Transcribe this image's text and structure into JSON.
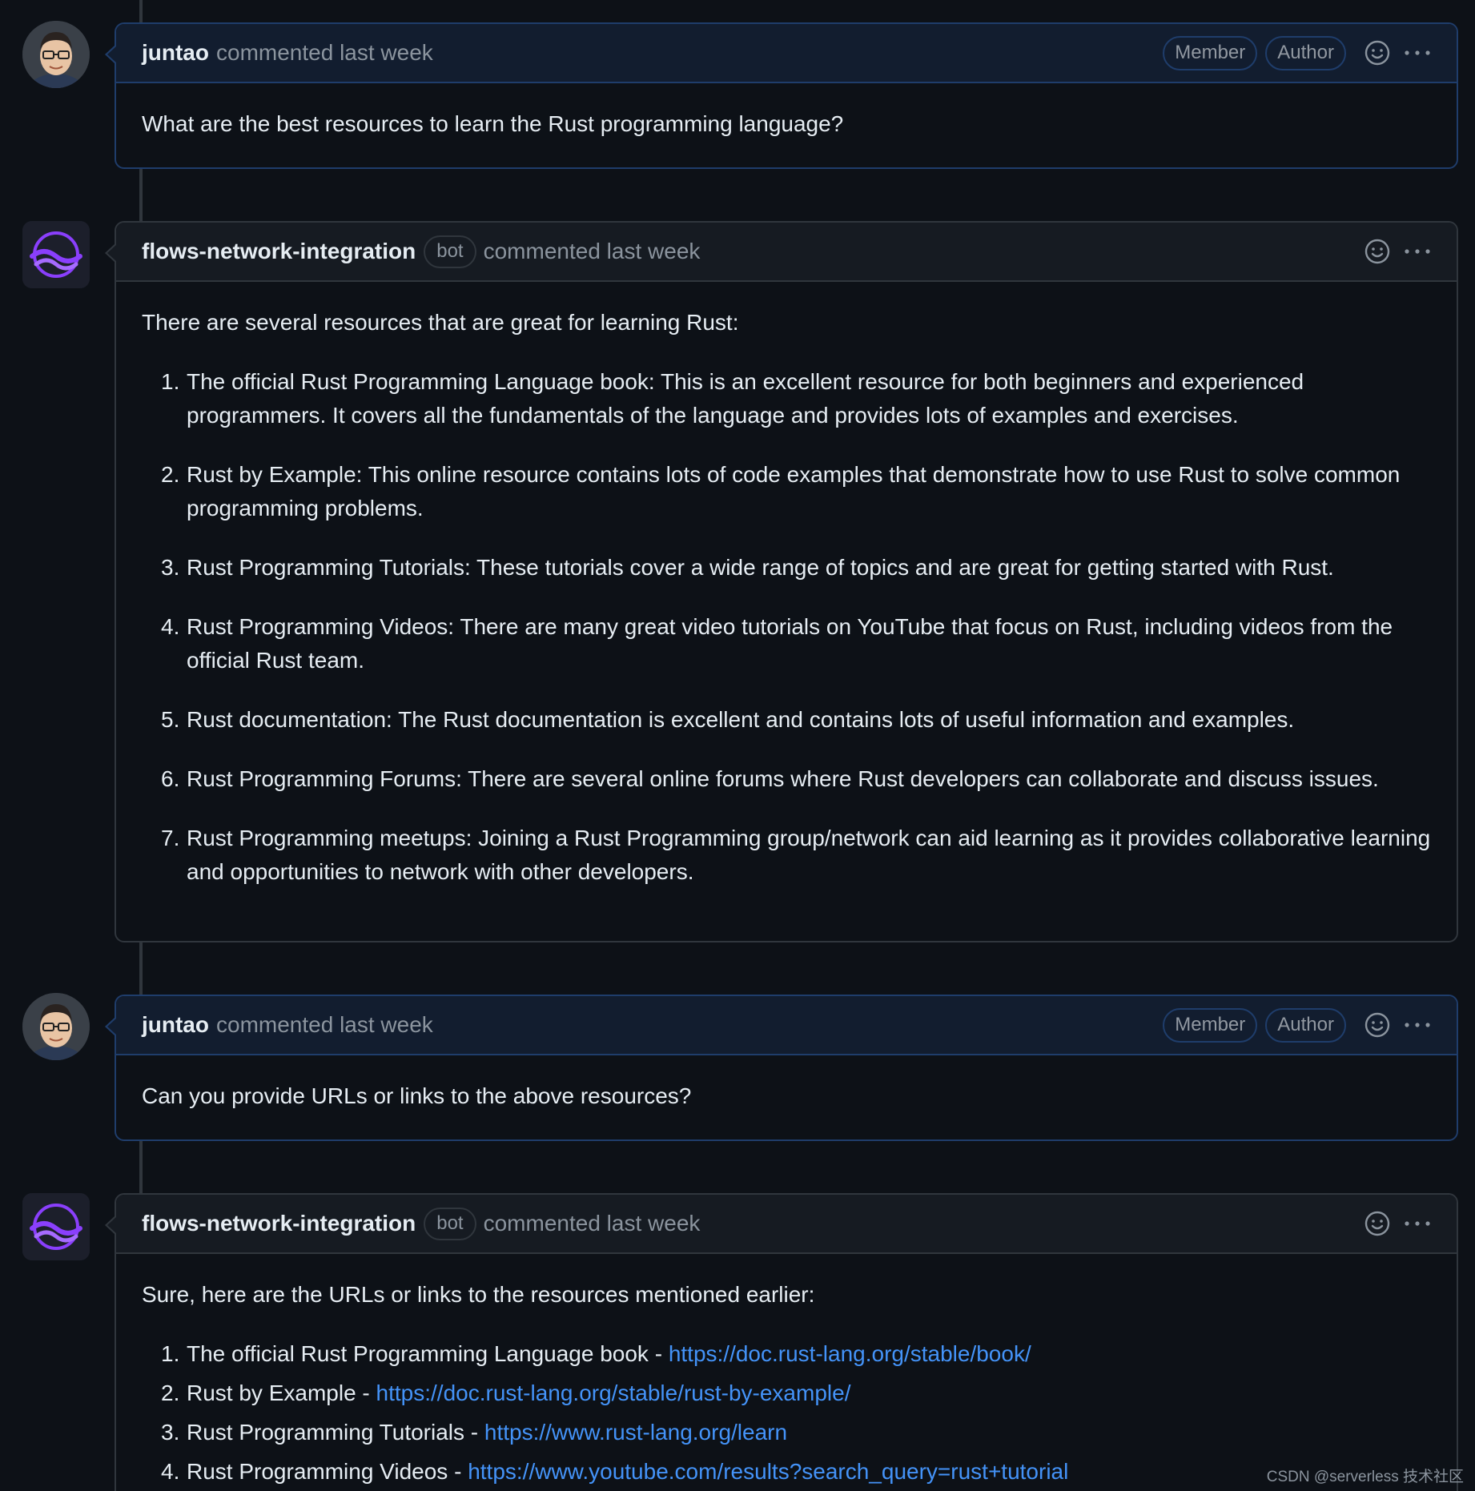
{
  "comments": [
    {
      "username": "juntao",
      "meta": "commented last week",
      "badges": [
        "Member",
        "Author"
      ],
      "body": "What are the best resources to learn the Rust programming language?"
    },
    {
      "username": "flows-network-integration",
      "bot_label": "bot",
      "meta": "commented last week",
      "intro": "There are several resources that are great for learning Rust:",
      "items": [
        {
          "num": "1.",
          "text": "The official Rust Programming Language book: This is an excellent resource for both beginners and experienced programmers. It covers all the fundamentals of the language and provides lots of examples and exercises."
        },
        {
          "num": "2.",
          "text": "Rust by Example: This online resource contains lots of code examples that demonstrate how to use Rust to solve common programming problems."
        },
        {
          "num": "3.",
          "text": "Rust Programming Tutorials: These tutorials cover a wide range of topics and are great for getting started with Rust."
        },
        {
          "num": "4.",
          "text": "Rust Programming Videos: There are many great video tutorials on YouTube that focus on Rust, including videos from the official Rust team."
        },
        {
          "num": "5.",
          "text": "Rust documentation: The Rust documentation is excellent and contains lots of useful information and examples."
        },
        {
          "num": "6.",
          "text": "Rust Programming Forums: There are several online forums where Rust developers can collaborate and discuss issues."
        },
        {
          "num": "7.",
          "text": "Rust Programming meetups: Joining a Rust Programming group/network can aid learning as it provides collaborative learning and opportunities to network with other developers."
        }
      ]
    },
    {
      "username": "juntao",
      "meta": "commented last week",
      "badges": [
        "Member",
        "Author"
      ],
      "body": "Can you provide URLs or links to the above resources?"
    },
    {
      "username": "flows-network-integration",
      "bot_label": "bot",
      "meta": "commented last week",
      "intro": "Sure, here are the URLs or links to the resources mentioned earlier:",
      "items": [
        {
          "num": "1.",
          "text": "The official Rust Programming Language book - ",
          "url": "https://doc.rust-lang.org/stable/book/"
        },
        {
          "num": "2.",
          "text": "Rust by Example - ",
          "url": "https://doc.rust-lang.org/stable/rust-by-example/"
        },
        {
          "num": "3.",
          "text": "Rust Programming Tutorials - ",
          "url": "https://www.rust-lang.org/learn"
        },
        {
          "num": "4.",
          "text": "Rust Programming Videos - ",
          "url": "https://www.youtube.com/results?search_query=rust+tutorial"
        }
      ]
    }
  ],
  "watermark": "CSDN @serverless 技术社区",
  "icons": {
    "reaction": "smiley-icon",
    "more": "kebab-horizontal-icon",
    "avatar_user": "user-avatar",
    "avatar_bot": "flows-logo-icon"
  },
  "colors": {
    "background": "#0d1117",
    "header": "#161b22",
    "author_border": "#1f3d6b",
    "link": "#4493f8",
    "muted": "#8b949e"
  }
}
